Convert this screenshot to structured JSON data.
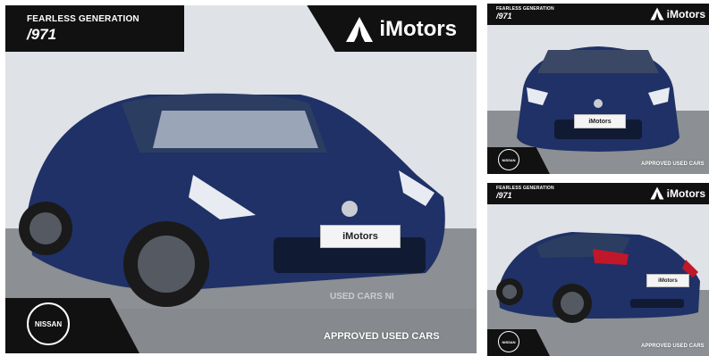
{
  "branding": {
    "tagline": "FEARLESS GENERATION",
    "year_mark": "/971",
    "dealer": "iMotors",
    "maker": "NISSAN",
    "footer": "APPROVED USED CARS",
    "watermark": "USED CARS NI"
  },
  "photos": [
    {
      "view": "front three-quarter",
      "body_color": "#1f3166"
    },
    {
      "view": "front",
      "body_color": "#1f3166"
    },
    {
      "view": "rear three-quarter",
      "body_color": "#1f3166"
    }
  ]
}
